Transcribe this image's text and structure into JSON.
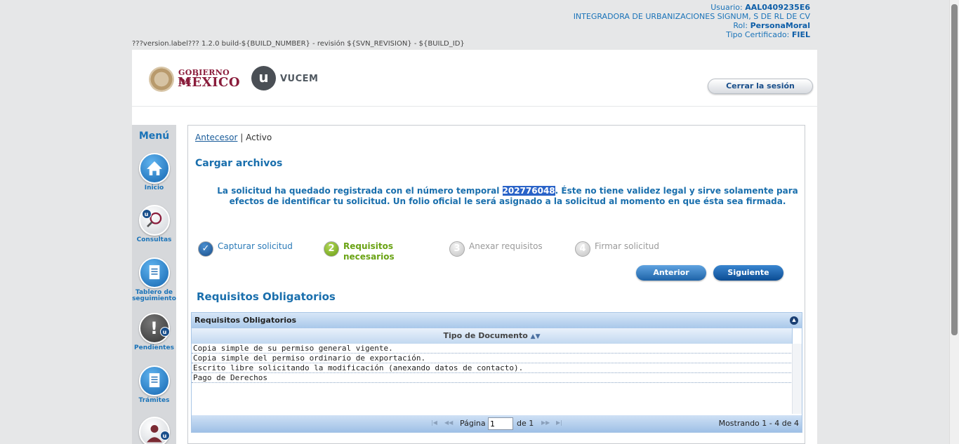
{
  "user": {
    "usuario_label": "Usuario:",
    "usuario": "AAL0409235E6",
    "company": "INTEGRADORA DE URBANIZACIONES SIGNUM, S DE RL DE CV",
    "rol_label": "Rol:",
    "rol": "PersonaMoral",
    "cert_label": "Tipo Certificado:",
    "cert": "FIEL"
  },
  "version": "???version.label??? 1.2.0 build-${BUILD_NUMBER} - revisión ${SVN_REVISION} - ${BUILD_ID}",
  "header": {
    "gob_line1": "GOBIERNO DE",
    "gob_line2": "MÉXICO",
    "vucem_mark": "u",
    "vucem_name": "VUCEM",
    "logout": "Cerrar la sesión"
  },
  "sidebar": {
    "title": "Menú",
    "items": [
      {
        "label": "Inicio",
        "icon": "home-icon"
      },
      {
        "label": "Consultas",
        "icon": "search-icon"
      },
      {
        "label": "Tablero de seguimiento",
        "icon": "document-icon"
      },
      {
        "label": "Pendientes",
        "icon": "alert-icon"
      },
      {
        "label": "Trámites",
        "icon": "document-icon"
      },
      {
        "label": "",
        "icon": "user-icon"
      }
    ]
  },
  "breadcrumb": {
    "link": "Antecesor",
    "sep": "|",
    "current": "Activo"
  },
  "page_title": "Cargar archivos",
  "notice": {
    "before": "La solicitud ha quedado registrada con el número temporal ",
    "number": "202776048",
    "after": ". Éste no tiene validez legal y sirve solamente para efectos de identificar tu solicitud. Un folio oficial le será asignado a la solicitud al momento en que ésta sea firmada."
  },
  "steps": [
    {
      "num": "✓",
      "label": "Capturar solicitud",
      "state": "done"
    },
    {
      "num": "2",
      "label": "Requisitos necesarios",
      "state": "current"
    },
    {
      "num": "3",
      "label": "Anexar requisitos",
      "state": "pending"
    },
    {
      "num": "4",
      "label": "Firmar solicitud",
      "state": "pending"
    }
  ],
  "buttons": {
    "prev": "Anterior",
    "next": "Siguiente"
  },
  "section_title": "Requisitos Obligatorios",
  "grid": {
    "caption": "Requisitos Obligatorios",
    "column": "Tipo de Documento",
    "rows": [
      "Copia simple de su permiso general vigente.",
      "Copia simple del permiso ordinario de exportación.",
      "Escrito libre solicitando la modificación (anexando datos de contacto).",
      "Pago de Derechos"
    ],
    "pager": {
      "page_label": "Página",
      "page_value": "1",
      "of_label": "de 1",
      "showing": "Mostrando 1 - 4 de 4"
    }
  }
}
